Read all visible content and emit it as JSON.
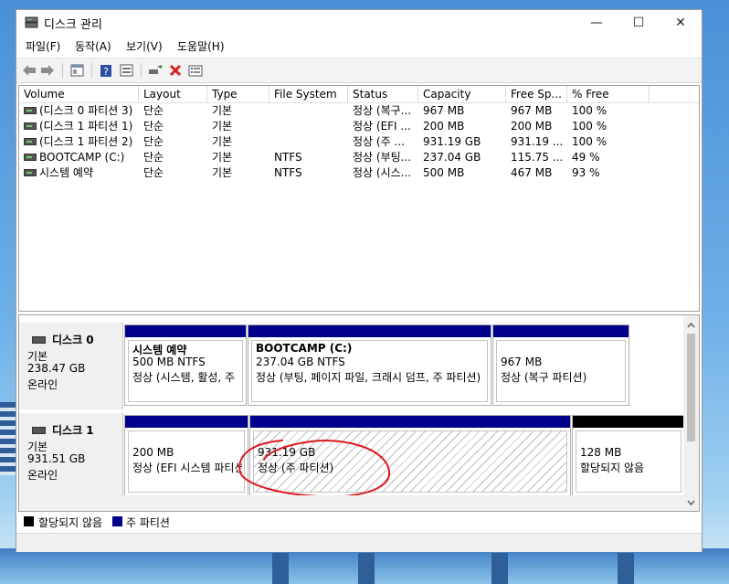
{
  "window": {
    "title": "디스크 관리",
    "minimize_glyph": "—",
    "maximize_glyph": "☐",
    "close_glyph": "✕"
  },
  "menu": [
    "파일(F)",
    "동작(A)",
    "보기(V)",
    "도움말(H)"
  ],
  "toolbar_icons": [
    "back-arrow-icon",
    "forward-arrow-icon",
    "properties-icon",
    "help-icon",
    "view-icon",
    "connect-icon",
    "delete-icon",
    "list-icon"
  ],
  "columns": [
    "Volume",
    "Layout",
    "Type",
    "File System",
    "Status",
    "Capacity",
    "Free Sp...",
    "% Free"
  ],
  "volumes": [
    {
      "volume": "(디스크 0 파티션 3)",
      "layout": "단순",
      "type": "기본",
      "fs": "",
      "status": "정상 (복구...",
      "capacity": "967 MB",
      "free": "967 MB",
      "pct": "100 %"
    },
    {
      "volume": "(디스크 1 파티션 1)",
      "layout": "단순",
      "type": "기본",
      "fs": "",
      "status": "정상 (EFI ...",
      "capacity": "200 MB",
      "free": "200 MB",
      "pct": "100 %"
    },
    {
      "volume": "(디스크 1 파티션 2)",
      "layout": "단순",
      "type": "기본",
      "fs": "",
      "status": "정상 (주 ...",
      "capacity": "931.19 GB",
      "free": "931.19 ...",
      "pct": "100 %"
    },
    {
      "volume": "BOOTCAMP (C:)",
      "layout": "단순",
      "type": "기본",
      "fs": "NTFS",
      "status": "정상 (부팅...",
      "capacity": "237.04 GB",
      "free": "115.75 ...",
      "pct": "49 %"
    },
    {
      "volume": "시스템 예약",
      "layout": "단순",
      "type": "기본",
      "fs": "NTFS",
      "status": "정상 (시스...",
      "capacity": "500 MB",
      "free": "467 MB",
      "pct": "93 %"
    }
  ],
  "disks": [
    {
      "name": "디스크 0",
      "kind": "기본",
      "size": "238.47 GB",
      "state": "온라인",
      "partitions": [
        {
          "title": "시스템 예약",
          "line1": "500 MB NTFS",
          "line2": "정상 (시스템, 활성, 주"
        },
        {
          "title": "BOOTCAMP  (C:)",
          "line1": "237.04 GB NTFS",
          "line2": "정상 (부팅, 페이지 파일, 크래시 덤프, 주 파티션)"
        },
        {
          "title": "",
          "line1": "967 MB",
          "line2": "정상 (복구 파티션)"
        }
      ]
    },
    {
      "name": "디스크 1",
      "kind": "기본",
      "size": "931.51 GB",
      "state": "온라인",
      "partitions": [
        {
          "title": "",
          "line1": "200 MB",
          "line2": "정상 (EFI 시스템 파티션)"
        },
        {
          "title": "",
          "line1": "931.19 GB",
          "line2": "정상 (주 파티션)"
        },
        {
          "title": "",
          "line1": "128 MB",
          "line2": "할당되지 않음"
        }
      ]
    }
  ],
  "legend": [
    {
      "label": "할당되지 않음",
      "color": "#000000"
    },
    {
      "label": "주 파티션",
      "color": "#00008b"
    }
  ],
  "colors": {
    "primary_partition": "#00008b",
    "unallocated": "#000000",
    "annotation": "#e0191f"
  }
}
